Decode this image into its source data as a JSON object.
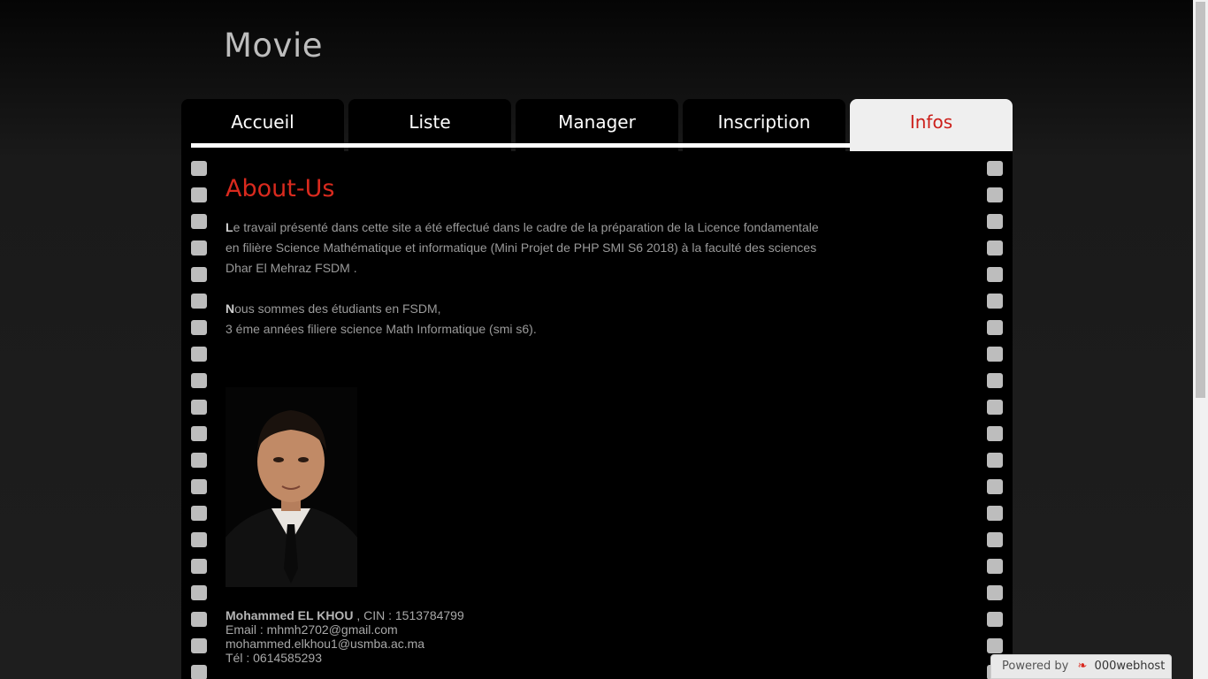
{
  "site": {
    "title": "Movie"
  },
  "nav": {
    "tabs": [
      {
        "label": "Accueil"
      },
      {
        "label": "Liste"
      },
      {
        "label": "Manager"
      },
      {
        "label": "Inscription"
      },
      {
        "label": "Infos"
      }
    ],
    "active": "Infos"
  },
  "content": {
    "heading": "About-Us",
    "p1_first": "L",
    "p1_rest": "e travail présenté dans cette site a été effectué dans le cadre de la préparation de la Licence fondamentale en filière Science Mathématique et informatique (Mini Projet de PHP SMI S6 2018) à la faculté des sciences Dhar El Mehraz FSDM .",
    "p2_first": "N",
    "p2_line1_rest": "ous sommes des étudiants en FSDM,",
    "p2_line2": "3 éme années filiere science Math Informatique (smi s6).",
    "name": "Mohammed EL KHOU",
    "cin": " , CIN : 1513784799",
    "email": "Email : mhmh2702@gmail.com",
    "email2": "mohammed.elkhou1@usmba.ac.ma",
    "tel": "Tél : 0614585293"
  },
  "badge": {
    "prefix": "Powered by",
    "brand": "000webhost"
  },
  "colors": {
    "accent": "#d92a1e",
    "background": "#000000",
    "tab_active_bg": "#efefef"
  }
}
